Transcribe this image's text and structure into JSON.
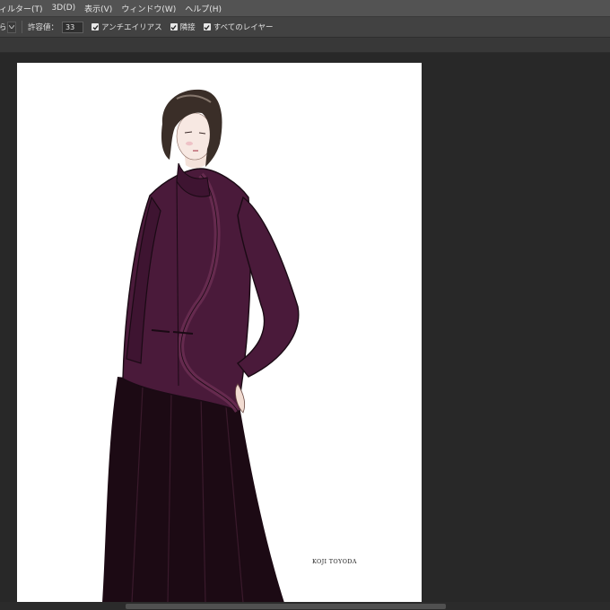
{
  "menubar": {
    "items": [
      {
        "label": "ィルター(T)"
      },
      {
        "label": "3D(D)"
      },
      {
        "label": "表示(V)"
      },
      {
        "label": "ウィンドウ(W)"
      },
      {
        "label": "ヘルプ(H)"
      }
    ]
  },
  "options_bar": {
    "left_fragment": "ら",
    "tolerance_label": "許容値：",
    "tolerance_value": "33",
    "antialias_label": "アンチエイリアス",
    "antialias_checked": true,
    "contiguous_label": "隣接",
    "contiguous_checked": true,
    "all_layers_label": "すべてのレイヤー",
    "all_layers_checked": true
  },
  "canvas": {
    "signature": "KOJI TOYODA",
    "artwork_icon": "fashion-illustration"
  },
  "colors": {
    "menubar_bg": "#535353",
    "options_bg": "#424242",
    "workspace_bg": "#282828",
    "jacket": "#4a1a3a",
    "skirt": "#1c0a14"
  }
}
